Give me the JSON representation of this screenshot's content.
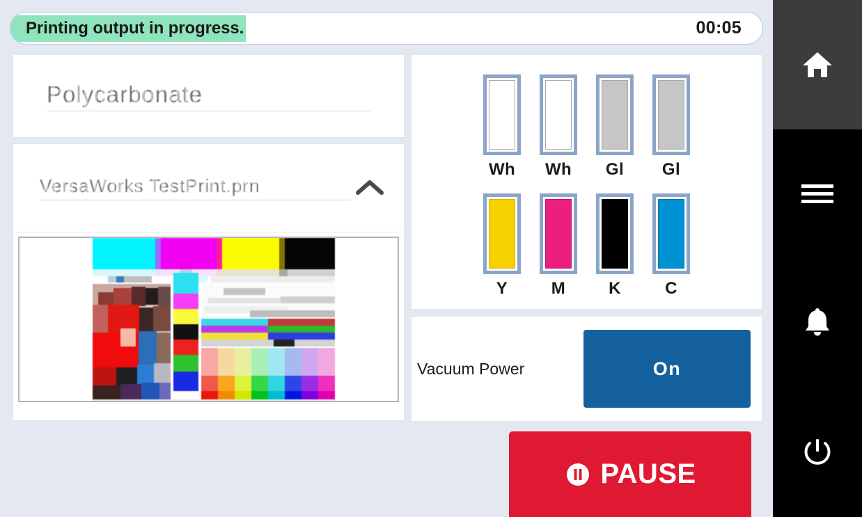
{
  "statusbar": {
    "message": "Printing output in progress.",
    "highlight_color": "#8fe3bd",
    "timer": "00:05"
  },
  "left": {
    "material": {
      "name": "Polycarbonate",
      "blurred": true
    },
    "job": {
      "name": "VersaWorks TestPrint.prn",
      "blurred": true,
      "collapse_icon": "chevron-up-icon"
    },
    "preview": {
      "caption": "",
      "description": "color test chart print preview"
    }
  },
  "inks": {
    "row1": [
      {
        "label": "Wh",
        "color": "#ffffff"
      },
      {
        "label": "Wh",
        "color": "#ffffff"
      },
      {
        "label": "Gl",
        "color": "#c6c6c9"
      },
      {
        "label": "Gl",
        "color": "#c6c6c9"
      }
    ],
    "row2": [
      {
        "label": "Y",
        "color": "#f7d000"
      },
      {
        "label": "M",
        "color": "#ec1f7f"
      },
      {
        "label": "K",
        "color": "#000000"
      },
      {
        "label": "C",
        "color": "#0090d4"
      }
    ],
    "cartridge_border_color": "#8ba4c8"
  },
  "vacuum": {
    "label": "Vacuum Power",
    "state": "On",
    "button_color": "#15619e"
  },
  "pause": {
    "label": "PAUSE",
    "icon": "pause-circle-icon",
    "color": "#e01933"
  },
  "sidebar": {
    "items": [
      {
        "name": "home",
        "icon": "home-icon",
        "active": true
      },
      {
        "name": "menu",
        "icon": "hamburger-menu-icon",
        "active": false
      },
      {
        "name": "notifications",
        "icon": "bell-icon",
        "active": false
      },
      {
        "name": "power",
        "icon": "power-icon",
        "active": false
      }
    ],
    "active_bg": "#3c3c3c",
    "bg": "#000000"
  }
}
